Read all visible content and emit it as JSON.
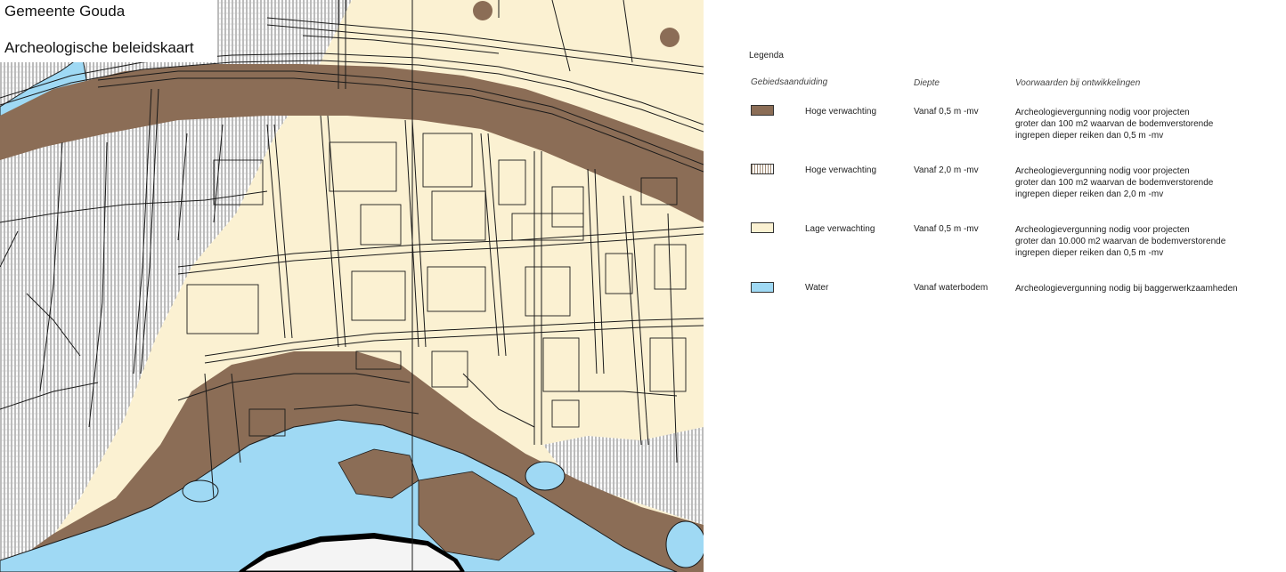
{
  "map": {
    "municipality": "Gemeente Gouda",
    "map_title": "Archeologische beleidskaart"
  },
  "colors": {
    "hoge": "#8b6d56",
    "hoge_hatch": "#a08a74",
    "lage": "#fbf1d2",
    "water": "#9fd9f4",
    "line": "#1a1a1a",
    "road_fill": "#ffffff"
  },
  "legend": {
    "title": "Legenda",
    "headers": {
      "area": "Gebiedsaanduiding",
      "depth": "Diepte",
      "conditions": "Voorwaarden bij ontwikkelingen"
    },
    "items": [
      {
        "swatch": "hoge",
        "label": "Hoge verwachting",
        "depth": "Vanaf 0,5 m -mv",
        "conditions": [
          "Archeologievergunning nodig voor projecten",
          "groter dan 100 m2 waarvan de bodemverstorende",
          "ingrepen dieper reiken dan 0,5 m -mv"
        ]
      },
      {
        "swatch": "hoge_hatch",
        "label": "Hoge verwachting",
        "depth": "Vanaf 2,0 m -mv",
        "conditions": [
          "Archeologievergunning nodig voor projecten",
          "groter dan 100 m2 waarvan de bodemverstorende",
          "ingrepen dieper reiken dan 2,0 m -mv"
        ]
      },
      {
        "swatch": "lage",
        "label": "Lage verwachting",
        "depth": "Vanaf 0,5 m -mv",
        "conditions": [
          "Archeologievergunning nodig voor projecten",
          "groter dan 10.000 m2 waarvan de bodemverstorende",
          "ingrepen dieper reiken dan 0,5 m -mv"
        ]
      },
      {
        "swatch": "water",
        "label": "Water",
        "depth": "Vanaf waterbodem",
        "conditions": [
          "Archeologievergunning nodig bij baggerwerkzaamheden"
        ]
      }
    ]
  }
}
